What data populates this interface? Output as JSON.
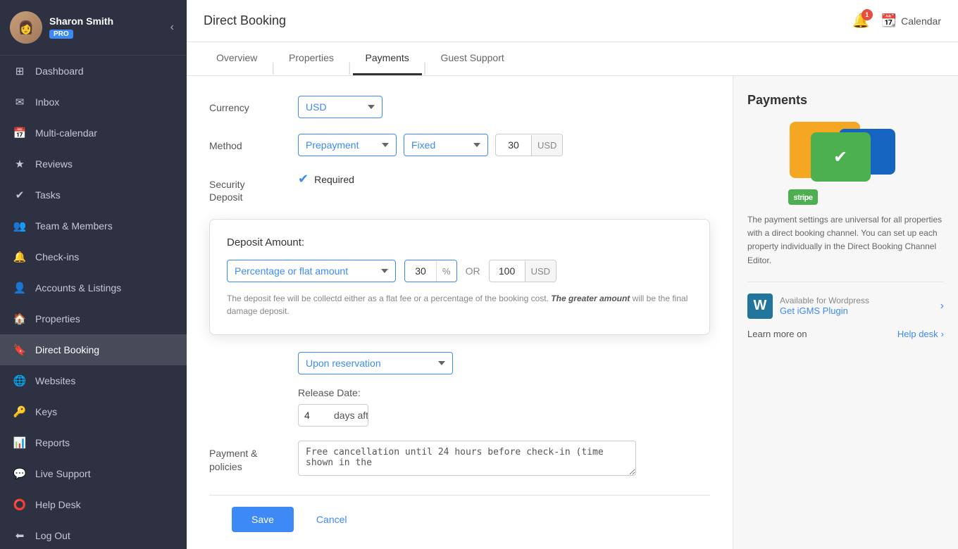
{
  "sidebar": {
    "user": {
      "name": "Sharon Smith",
      "badge": "PRO"
    },
    "items": [
      {
        "id": "dashboard",
        "icon": "⊞",
        "label": "Dashboard",
        "active": false
      },
      {
        "id": "inbox",
        "icon": "✉",
        "label": "Inbox",
        "active": false
      },
      {
        "id": "multi-calendar",
        "icon": "📅",
        "label": "Multi-calendar",
        "active": false
      },
      {
        "id": "reviews",
        "icon": "★",
        "label": "Reviews",
        "active": false
      },
      {
        "id": "tasks",
        "icon": "✔",
        "label": "Tasks",
        "active": false
      },
      {
        "id": "team-members",
        "icon": "👥",
        "label": "Team & Members",
        "active": false
      },
      {
        "id": "check-ins",
        "icon": "🔔",
        "label": "Check-ins",
        "active": false
      },
      {
        "id": "accounts-listings",
        "icon": "👤",
        "label": "Accounts & Listings",
        "active": false
      },
      {
        "id": "properties",
        "icon": "🏠",
        "label": "Properties",
        "active": false
      },
      {
        "id": "direct-booking",
        "icon": "🔖",
        "label": "Direct Booking",
        "active": true
      },
      {
        "id": "websites",
        "icon": "🌐",
        "label": "Websites",
        "active": false
      },
      {
        "id": "keys",
        "icon": "🔑",
        "label": "Keys",
        "active": false
      },
      {
        "id": "reports",
        "icon": "📊",
        "label": "Reports",
        "active": false
      },
      {
        "id": "live-support",
        "icon": "💬",
        "label": "Live Support",
        "active": false
      },
      {
        "id": "help-desk",
        "icon": "⭕",
        "label": "Help Desk",
        "active": false
      },
      {
        "id": "log-out",
        "icon": "⬅",
        "label": "Log Out",
        "active": false
      }
    ]
  },
  "header": {
    "title": "Direct Booking",
    "notifications_count": "1",
    "calendar_label": "Calendar"
  },
  "tabs": [
    {
      "id": "overview",
      "label": "Overview",
      "active": false
    },
    {
      "id": "properties",
      "label": "Properties",
      "active": false
    },
    {
      "id": "payments",
      "label": "Payments",
      "active": true
    },
    {
      "id": "guest-support",
      "label": "Guest Support",
      "active": false
    }
  ],
  "form": {
    "currency_label": "Currency",
    "currency_value": "USD",
    "method_label": "Method",
    "method_prepayment": "Prepayment",
    "method_fixed": "Fixed",
    "method_amount": "30",
    "method_unit": "USD",
    "security_label": "Security\nDeposit",
    "required_label": "Required",
    "deposit_amount_label": "Deposit Amount:",
    "deposit_select": "Percentage or flat amount",
    "deposit_pct_value": "30",
    "deposit_pct_unit": "%",
    "deposit_or": "OR",
    "deposit_usd_value": "100",
    "deposit_usd_unit": "USD",
    "deposit_note": "The deposit fee will be collectd either as a flat fee or a percentage of the booking cost.",
    "deposit_note_bold": "The greater amount",
    "deposit_note_end": "will be the final damage deposit.",
    "upon_reservation": "Upon reservation",
    "release_date_label": "Release Date:",
    "release_days": "4",
    "days_after_checkout": "days after checkout",
    "payment_label": "Payment &\npolicies",
    "payment_value": "Free cancellation until 24 hours before check-in (time shown in the"
  },
  "buttons": {
    "save": "Save",
    "cancel": "Cancel"
  },
  "right_panel": {
    "title": "Payments",
    "description": "The payment settings are universal for all properties with a direct booking channel. You can set up each property individually in the Direct Booking Channel Editor.",
    "wordpress_label": "Available for Wordpress",
    "wordpress_link": "Get iGMS Plugin",
    "helpdesk_label": "Learn more on",
    "helpdesk_link": "Help desk"
  }
}
